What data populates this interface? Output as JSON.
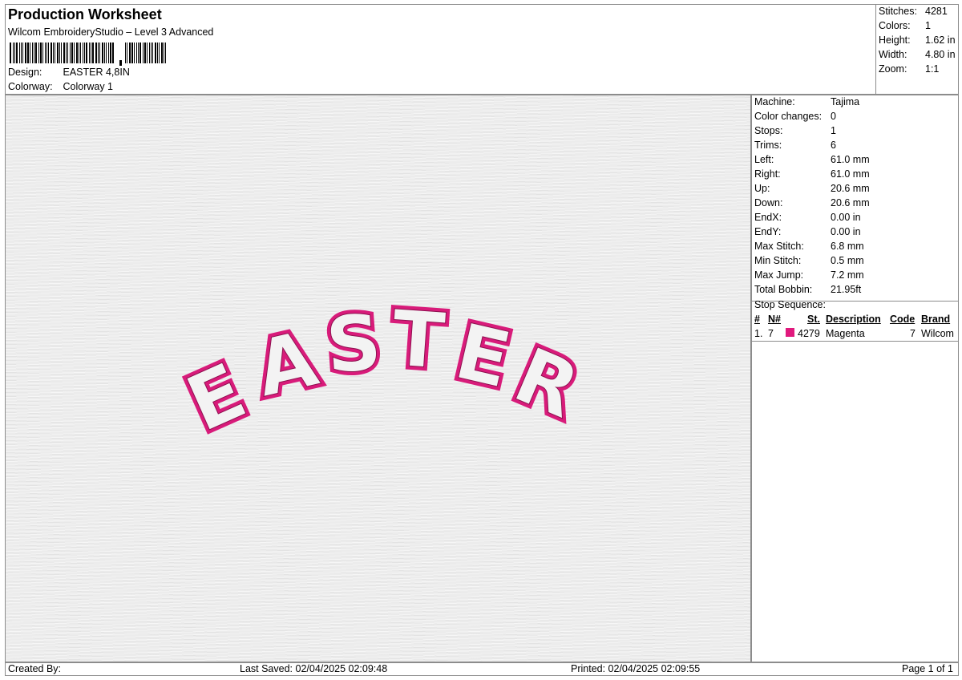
{
  "header": {
    "title": "Production Worksheet",
    "software": "Wilcom EmbroideryStudio – Level 3 Advanced",
    "design_label": "Design:",
    "design_value": "EASTER 4,8IN",
    "colorway_label": "Colorway:",
    "colorway_value": "Colorway 1"
  },
  "summary": [
    {
      "label": "Stitches:",
      "value": "4281"
    },
    {
      "label": "Colors:",
      "value": "1"
    },
    {
      "label": "Height:",
      "value": "1.62 in"
    },
    {
      "label": "Width:",
      "value": "4.80 in"
    },
    {
      "label": "Zoom:",
      "value": "1:1"
    }
  ],
  "details": [
    {
      "label": "Machine:",
      "value": "Tajima"
    },
    {
      "label": "Color changes:",
      "value": "0"
    },
    {
      "label": "Stops:",
      "value": "1"
    },
    {
      "label": "Trims:",
      "value": "6"
    },
    {
      "label": "Left:",
      "value": "61.0 mm"
    },
    {
      "label": "Right:",
      "value": "61.0 mm"
    },
    {
      "label": "Up:",
      "value": "20.6 mm"
    },
    {
      "label": "Down:",
      "value": "20.6 mm"
    },
    {
      "label": "EndX:",
      "value": "0.00 in"
    },
    {
      "label": "EndY:",
      "value": "0.00 in"
    },
    {
      "label": "Max Stitch:",
      "value": "6.8 mm"
    },
    {
      "label": "Min Stitch:",
      "value": "0.5 mm"
    },
    {
      "label": "Max Jump:",
      "value": "7.2 mm"
    },
    {
      "label": "Total Bobbin:",
      "value": "21.95ft"
    }
  ],
  "stop_sequence": {
    "title": "Stop Sequence:",
    "headers": {
      "num": "#",
      "n": "N#",
      "st": "St.",
      "description": "Description",
      "code": "Code",
      "brand": "Brand"
    },
    "rows": [
      {
        "num": "1.",
        "n": "7",
        "st": "4279",
        "description": "Magenta",
        "code": "7",
        "brand": "Wilcom",
        "color": "#e0197d"
      }
    ]
  },
  "design": {
    "text": "EASTER",
    "letters": [
      "E",
      "A",
      "S",
      "T",
      "E",
      "R"
    ],
    "thread_color": "#d81b7a",
    "outline_color": "#8e1150"
  },
  "footer": {
    "created_by": "Created By:",
    "last_saved": "Last Saved: 02/04/2025 02:09:48",
    "printed": "Printed: 02/04/2025 02:09:55",
    "page": "Page 1 of 1"
  }
}
